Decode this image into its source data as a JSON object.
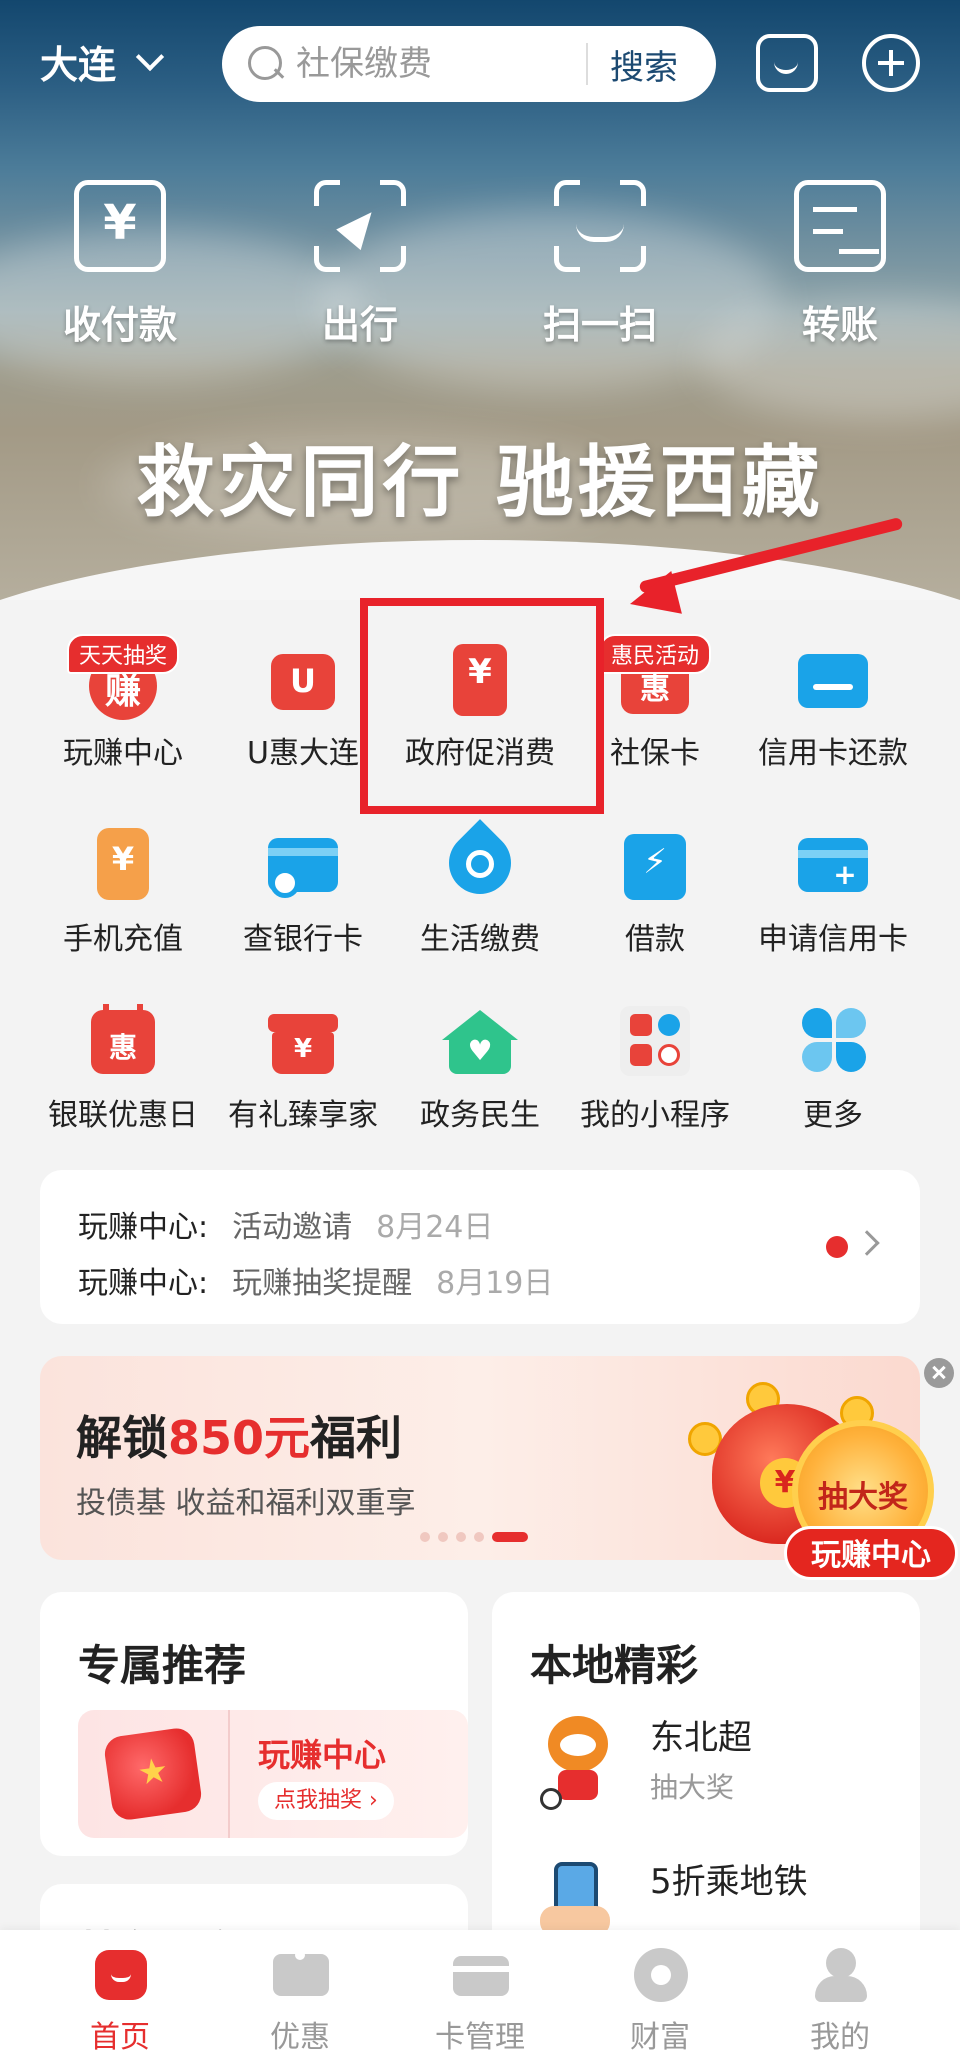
{
  "header": {
    "city": "大连",
    "search_placeholder": "社保缴费",
    "search_button": "搜索"
  },
  "quick_actions": [
    {
      "label": "收付款",
      "icon": "pay-receive-icon"
    },
    {
      "label": "出行",
      "icon": "travel-icon"
    },
    {
      "label": "扫一扫",
      "icon": "scan-icon"
    },
    {
      "label": "转账",
      "icon": "transfer-icon"
    }
  ],
  "banner": {
    "title": "救灾同行 驰援西藏"
  },
  "services": [
    {
      "label": "玩赚中心",
      "badge": "天天抽奖",
      "icon": "earn-center-icon",
      "glyph": "赚",
      "color": "#e8433a"
    },
    {
      "label": "U惠大连",
      "icon": "u-hui-icon",
      "glyph": "U",
      "color": "#e8433a"
    },
    {
      "label": "政府促消费",
      "icon": "gov-voucher-icon",
      "glyph": "¥",
      "color": "#e8433a"
    },
    {
      "label": "社保卡",
      "badge": "惠民活动",
      "icon": "social-card-icon",
      "glyph": "惠",
      "color": "#e8433a"
    },
    {
      "label": "信用卡还款",
      "icon": "credit-repay-icon",
      "glyph": "",
      "color": "#1aa3e8"
    },
    {
      "label": "手机充值",
      "icon": "phone-topup-icon",
      "glyph": "¥",
      "color": "#f5a04a"
    },
    {
      "label": "查银行卡",
      "icon": "bank-card-icon",
      "glyph": "",
      "color": "#1aa3e8"
    },
    {
      "label": "生活缴费",
      "icon": "utility-drop-icon",
      "glyph": "",
      "color": "#1aa3e8"
    },
    {
      "label": "借款",
      "icon": "loan-icon",
      "glyph": "⚡",
      "color": "#1aa3e8"
    },
    {
      "label": "申请信用卡",
      "icon": "apply-card-icon",
      "glyph": "+",
      "color": "#1aa3e8"
    },
    {
      "label": "银联优惠日",
      "icon": "calendar-icon",
      "glyph": "惠",
      "color": "#e8433a"
    },
    {
      "label": "有礼臻享家",
      "icon": "gift-icon",
      "glyph": "¥",
      "color": "#e8433a"
    },
    {
      "label": "政务民生",
      "icon": "house-heart-icon",
      "glyph": "♥",
      "color": "#2fc48c"
    },
    {
      "label": "我的小程序",
      "icon": "mini-program-icon",
      "glyph": "",
      "color": "#eeeeee"
    },
    {
      "label": "更多",
      "icon": "more-icon",
      "glyph": "",
      "color": "#1aa3e8"
    }
  ],
  "notices": [
    {
      "source": "玩赚中心:",
      "text": "活动邀请",
      "date": "8月24日"
    },
    {
      "source": "玩赚中心:",
      "text": "玩赚抽奖提醒",
      "date": "8月19日"
    }
  ],
  "promo": {
    "prefix": "解锁",
    "highlight": "850元",
    "suffix": "福利",
    "subtitle": "投债基 收益和福利双重享",
    "prize_label": "抽大奖",
    "tag_label": "玩赚中心",
    "bag_glyph": "¥"
  },
  "recommend": {
    "title": "专属推荐",
    "item_name": "玩赚中心",
    "item_button": "点我抽奖 ›"
  },
  "local": {
    "title": "本地精彩",
    "items": [
      {
        "name": "东北超",
        "sub": "抽大奖"
      },
      {
        "name": "5折乘地铁",
        "sub": ""
      }
    ]
  },
  "third_card": {
    "title": "特色服务"
  },
  "tabs": [
    {
      "label": "首页",
      "active": true
    },
    {
      "label": "优惠",
      "active": false
    },
    {
      "label": "卡管理",
      "active": false
    },
    {
      "label": "财富",
      "active": false
    },
    {
      "label": "我的",
      "active": false
    }
  ],
  "colors": {
    "accent": "#e62e2e",
    "brand_blue": "#1c4a72",
    "highlight_box": "#e8222a"
  }
}
